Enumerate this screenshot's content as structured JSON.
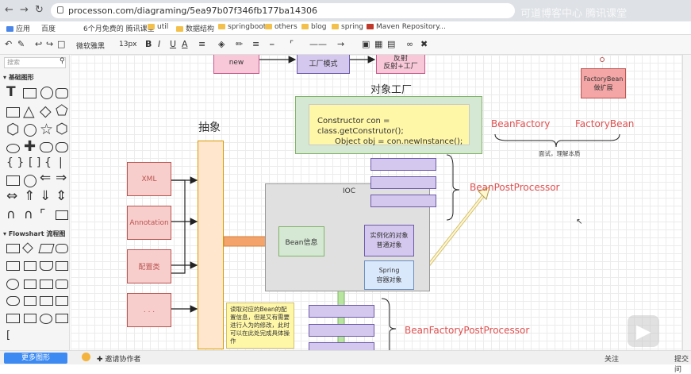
{
  "browser": {
    "url": "processon.com/diagraming/5ea97b07f346fb177ba14306",
    "watermark": "可道博客中心 腾讯课堂",
    "bookmarks": [
      "应用",
      "百度",
      "6个月免费的 腾讯课堂",
      "util",
      "数据结构",
      "springboot",
      "others",
      "blog",
      "spring",
      "Maven Repository..."
    ]
  },
  "toolbar": {
    "font": "微软雅黑",
    "size": "13px",
    "bold": "B",
    "italic": "I",
    "underline": "U",
    "color": "A"
  },
  "sidebar": {
    "search_placeholder": "搜索",
    "basic_title": "基础图形",
    "flow_title": "Flowshart 流程图"
  },
  "bottom": {
    "more_shapes": "更多图形",
    "invite": "邀请协作者",
    "follow": "关注",
    "submit": "提交问"
  },
  "diagram": {
    "top_new": "new",
    "top_factory": "工厂模式",
    "top_reflect_line1": "反射",
    "top_reflect_line2": "反射+工厂",
    "factory_title": "对象工厂",
    "constructor_line": "Constructor con = class.getConstrutor();",
    "object_line": "Object obj = con.newInstance();",
    "abstract_label": "抽象",
    "xml": "XML",
    "annotation": "Annotation",
    "config": "配置类",
    "dots": ". . .",
    "ioc": "IOC",
    "bean_info": "Bean信息",
    "instantiated_line1": "实例化的对象",
    "instantiated_line2": "普通对象",
    "spring_line1": "Spring",
    "spring_line2": "容器对象",
    "note": "读取对应的Bean的配置信息，但是又有需要进行人为的修改，此时可以在此处完成具体操作",
    "factorybean_line1": "FactoryBean",
    "factorybean_line2": "做扩展",
    "beanfactory": "BeanFactory",
    "factorybean_red": "FactoryBean",
    "brace_caption": "面试，理解本质",
    "bpp": "BeanPostProcessor",
    "bfpp": "BeanFactoryPostProcessor"
  }
}
